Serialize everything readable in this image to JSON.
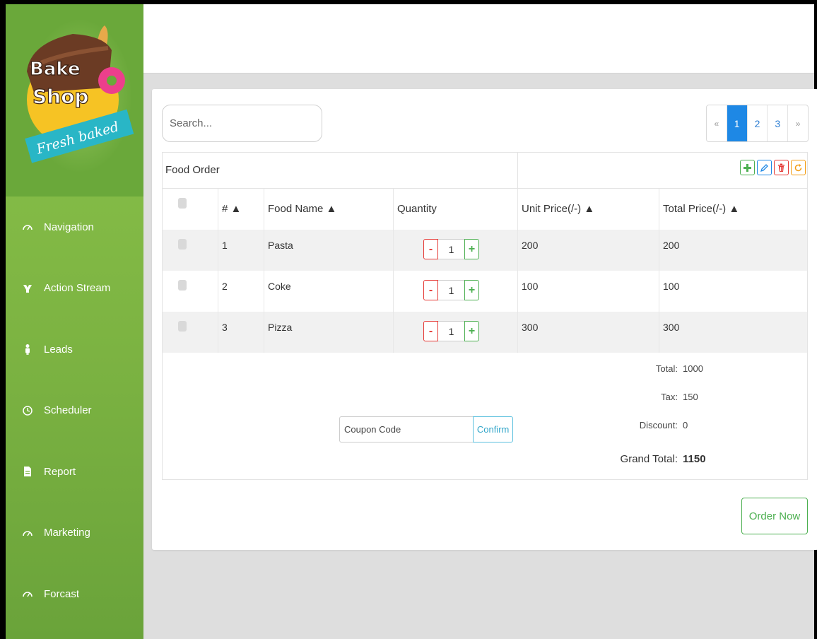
{
  "brand": {
    "name_line1": "Bake",
    "name_line2": "Shop",
    "tagline": "Fresh baked"
  },
  "sidebar": {
    "items": [
      {
        "label": "Navigation",
        "icon": "gauge-icon"
      },
      {
        "label": "Action Stream",
        "icon": "action-stream-icon"
      },
      {
        "label": "Leads",
        "icon": "people-icon"
      },
      {
        "label": "Scheduler",
        "icon": "clock-icon"
      },
      {
        "label": "Report",
        "icon": "document-icon"
      },
      {
        "label": "Marketing",
        "icon": "gauge-icon"
      },
      {
        "label": "Forcast",
        "icon": "gauge-icon"
      }
    ]
  },
  "search": {
    "placeholder": "Search..."
  },
  "pagination": {
    "prev": "«",
    "pages": [
      "1",
      "2",
      "3"
    ],
    "next": "»",
    "active": "1"
  },
  "table": {
    "title": "Food Order",
    "columns": [
      "# ▲",
      "Food Name ▲",
      "Quantity",
      "Unit Price(/-) ▲",
      "Total Price(/-) ▲"
    ],
    "rows": [
      {
        "num": "1",
        "name": "Pasta",
        "qty": "1",
        "unit": "200",
        "total": "200"
      },
      {
        "num": "2",
        "name": "Coke",
        "qty": "1",
        "unit": "100",
        "total": "100"
      },
      {
        "num": "3",
        "name": "Pizza",
        "qty": "1",
        "unit": "300",
        "total": "300"
      }
    ],
    "qty_minus": "-",
    "qty_plus": "+"
  },
  "summary": {
    "total_label": "Total:",
    "total": "1000",
    "tax_label": "Tax:",
    "tax": "150",
    "discount_label": "Discount:",
    "discount": "0",
    "grand_label": "Grand Total:",
    "grand": "1150"
  },
  "coupon": {
    "placeholder": "Coupon Code",
    "button": "Confirm"
  },
  "order_button": "Order Now",
  "colors": {
    "sidebar": "#8bc34a",
    "primary": "#1e88e5",
    "success": "#4caf50",
    "danger": "#e53935",
    "warning": "#f39c12",
    "info": "#5bc0de"
  }
}
